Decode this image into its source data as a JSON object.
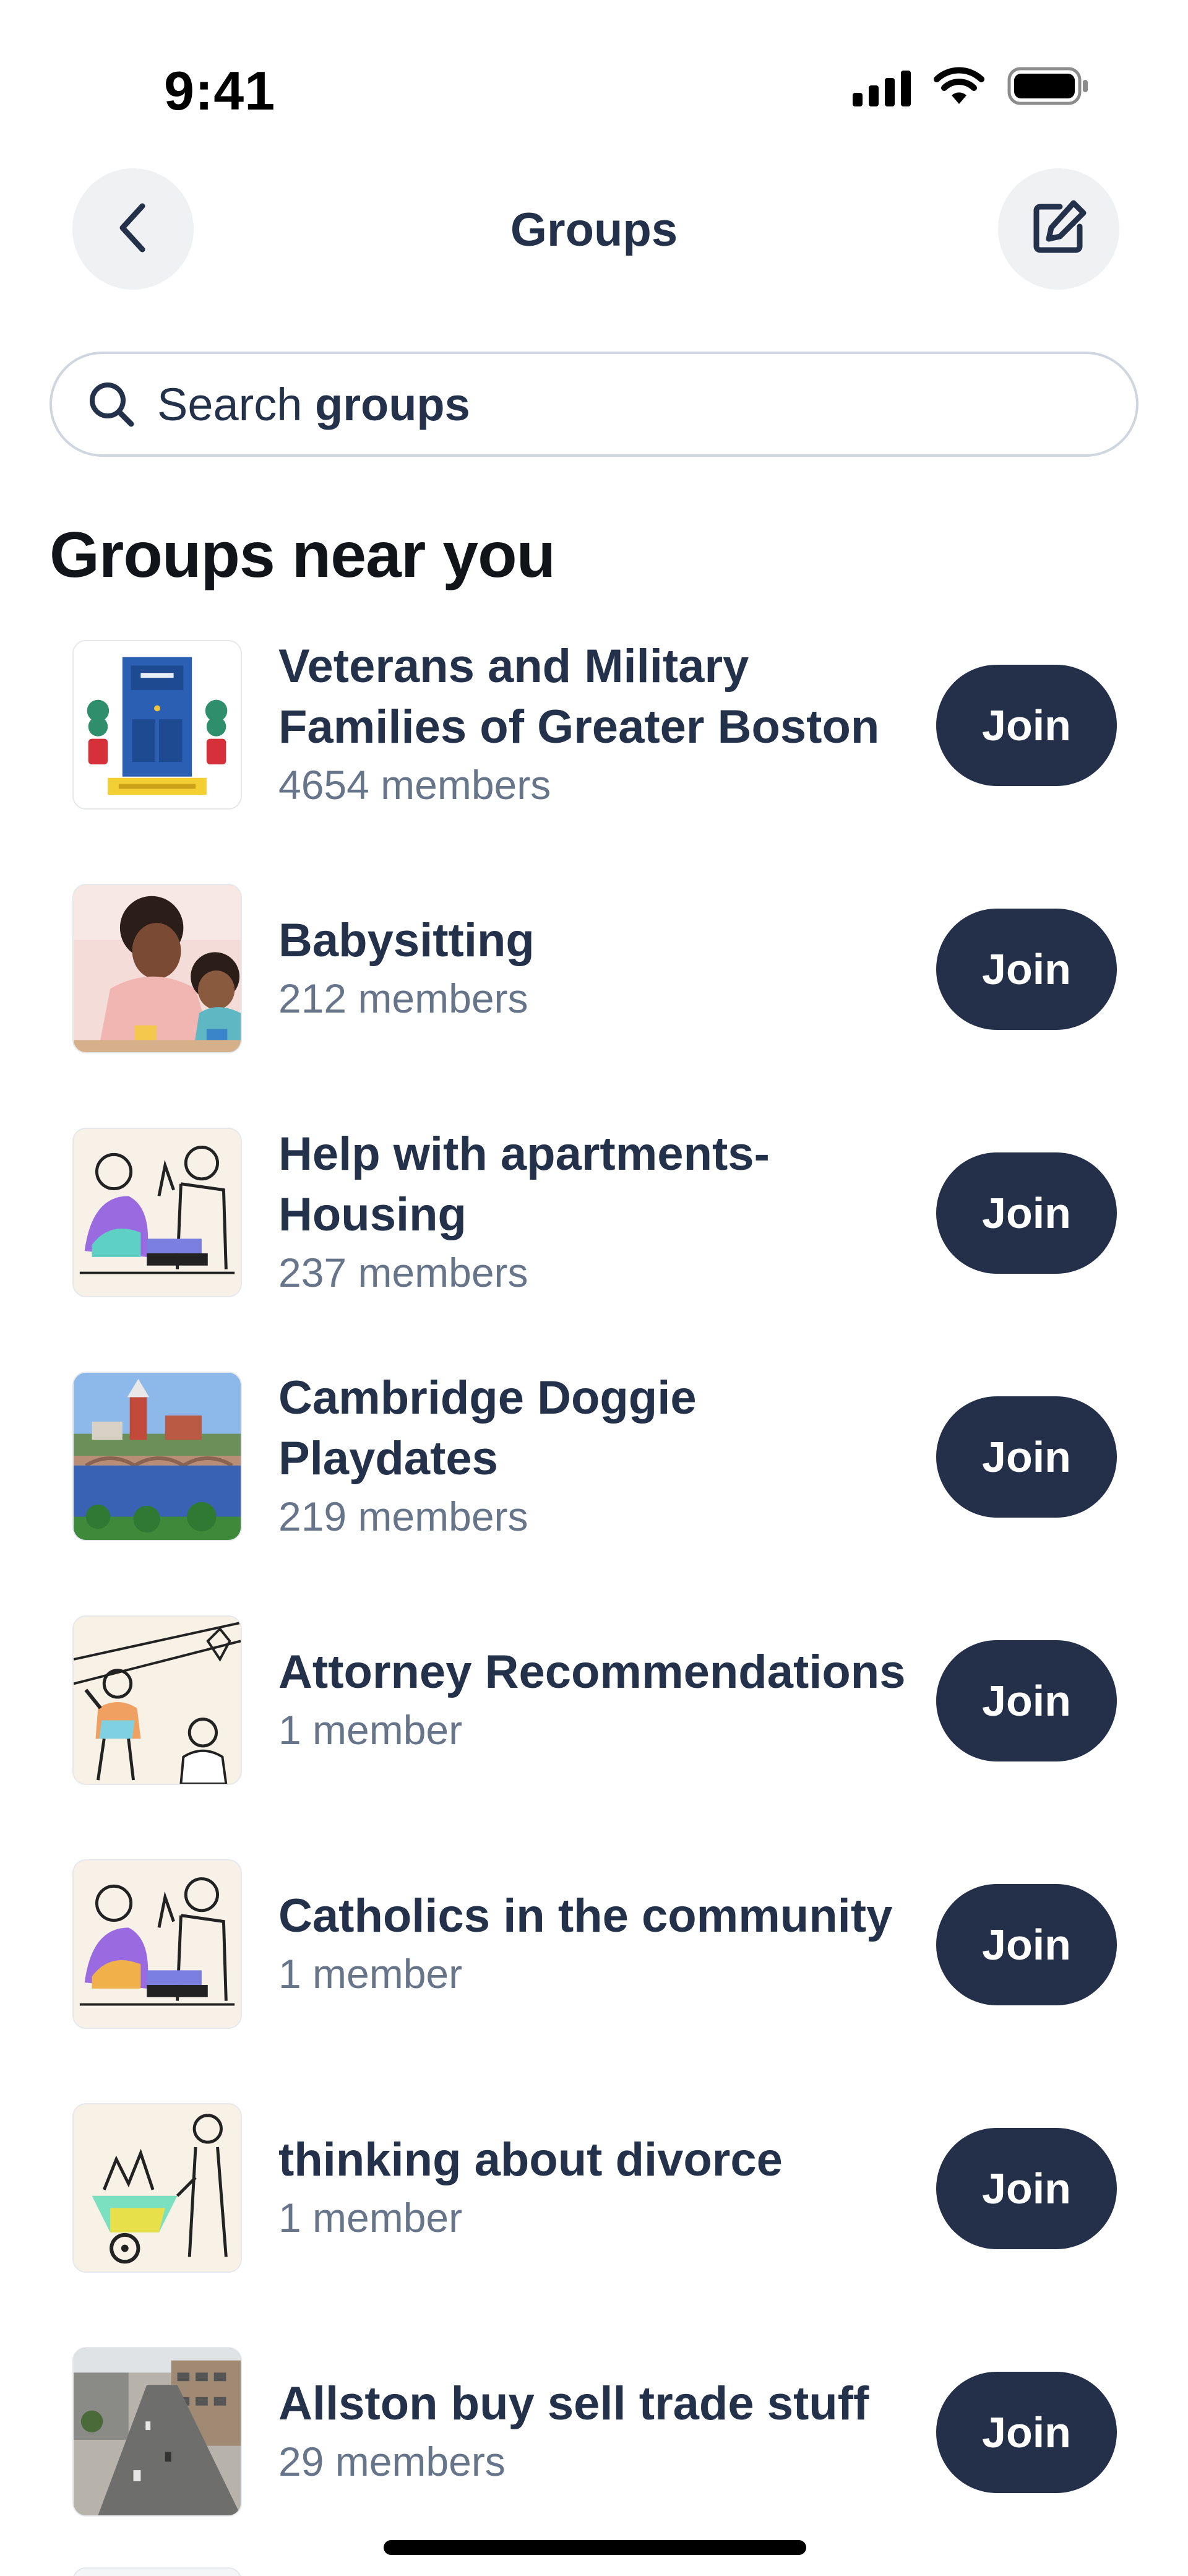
{
  "status_bar": {
    "time": "9:41",
    "icons": [
      "cellular-signal-icon",
      "wifi-icon",
      "battery-icon"
    ]
  },
  "header": {
    "title": "Groups",
    "back_icon": "chevron-left-icon",
    "compose_icon": "compose-icon"
  },
  "search": {
    "prefix": "Search ",
    "emphasis": "groups",
    "icon": "search-icon"
  },
  "section": {
    "title": "Groups near you"
  },
  "groups": [
    {
      "name": "Veterans and Military Families of Greater Boston",
      "members": "4654 members",
      "join_label": "Join",
      "thumbnail": "welcome-door-illustration"
    },
    {
      "name": "Babysitting",
      "members": "212 members",
      "join_label": "Join",
      "thumbnail": "mother-and-child-photo"
    },
    {
      "name": "Help with apartments-Housing",
      "members": "237 members",
      "join_label": "Join",
      "thumbnail": "neighbors-illustration"
    },
    {
      "name": "Cambridge Doggie Playdates",
      "members": "219 members",
      "join_label": "Join",
      "thumbnail": "river-bridge-photo"
    },
    {
      "name": "Attorney Recommendations",
      "members": "1 member",
      "join_label": "Join",
      "thumbnail": "people-waving-illustration"
    },
    {
      "name": "Catholics in the community",
      "members": "1 member",
      "join_label": "Join",
      "thumbnail": "neighbors-illustration"
    },
    {
      "name": "thinking about divorce",
      "members": "1 member",
      "join_label": "Join",
      "thumbnail": "wheelbarrow-illustration"
    },
    {
      "name": "Allston buy sell trade stuff",
      "members": "29 members",
      "join_label": "Join",
      "thumbnail": "street-aerial-photo"
    }
  ],
  "colors": {
    "primary_text": "#23314a",
    "secondary_text": "#66758a",
    "heading": "#111418",
    "join_button": "#24304a",
    "icon_button_bg": "#f0f1f3",
    "search_border": "#cfd6e0"
  }
}
